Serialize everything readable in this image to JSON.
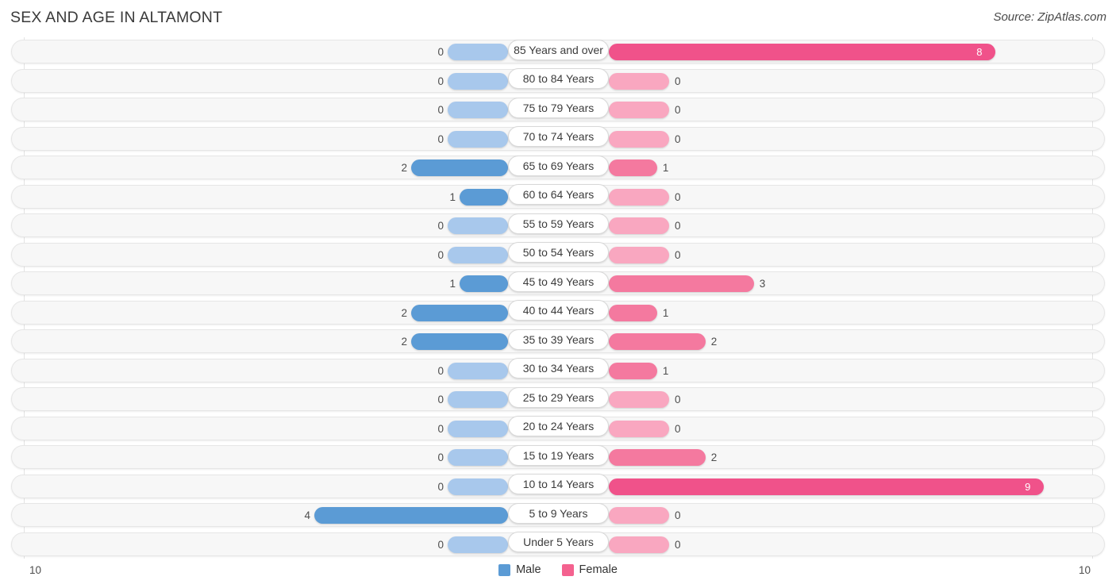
{
  "header": {
    "title": "SEX AND AGE IN ALTAMONT",
    "source": "Source: ZipAtlas.com"
  },
  "legend": {
    "male_label": "Male",
    "female_label": "Female",
    "male_color": "#5b9bd5",
    "female_color": "#f4628f"
  },
  "axis": {
    "left_label": "10",
    "right_label": "10"
  },
  "colors": {
    "male_filled": "#5b9bd5",
    "male_empty": "#a8c8ec",
    "female_filled": "#f4799f",
    "female_strong": "#f0528a",
    "female_empty": "#f9a7c0",
    "track": "#f7f7f7",
    "gridline": "#e3e3e3"
  },
  "chart_data": {
    "type": "bar",
    "title": "SEX AND AGE IN ALTAMONT",
    "subtitle": "Source: ZipAtlas.com",
    "xlabel": "",
    "ylabel": "",
    "orientation": "horizontal",
    "layout": "population-pyramid",
    "xlim": [
      10,
      10
    ],
    "axis_max": 10,
    "grid": true,
    "legend_position": "bottom-center",
    "categories": [
      "85 Years and over",
      "80 to 84 Years",
      "75 to 79 Years",
      "70 to 74 Years",
      "65 to 69 Years",
      "60 to 64 Years",
      "55 to 59 Years",
      "50 to 54 Years",
      "45 to 49 Years",
      "40 to 44 Years",
      "35 to 39 Years",
      "30 to 34 Years",
      "25 to 29 Years",
      "20 to 24 Years",
      "15 to 19 Years",
      "10 to 14 Years",
      "5 to 9 Years",
      "Under 5 Years"
    ],
    "series": [
      {
        "name": "Male",
        "values": [
          0,
          0,
          0,
          0,
          2,
          1,
          0,
          0,
          1,
          2,
          2,
          0,
          0,
          0,
          0,
          0,
          4,
          0
        ]
      },
      {
        "name": "Female",
        "values": [
          8,
          0,
          0,
          0,
          1,
          0,
          0,
          0,
          3,
          1,
          2,
          1,
          0,
          0,
          2,
          9,
          0,
          0
        ]
      }
    ]
  },
  "rows": [
    {
      "label": "85 Years and over",
      "male": "0",
      "female": "8"
    },
    {
      "label": "80 to 84 Years",
      "male": "0",
      "female": "0"
    },
    {
      "label": "75 to 79 Years",
      "male": "0",
      "female": "0"
    },
    {
      "label": "70 to 74 Years",
      "male": "0",
      "female": "0"
    },
    {
      "label": "65 to 69 Years",
      "male": "2",
      "female": "1"
    },
    {
      "label": "60 to 64 Years",
      "male": "1",
      "female": "0"
    },
    {
      "label": "55 to 59 Years",
      "male": "0",
      "female": "0"
    },
    {
      "label": "50 to 54 Years",
      "male": "0",
      "female": "0"
    },
    {
      "label": "45 to 49 Years",
      "male": "1",
      "female": "3"
    },
    {
      "label": "40 to 44 Years",
      "male": "2",
      "female": "1"
    },
    {
      "label": "35 to 39 Years",
      "male": "2",
      "female": "2"
    },
    {
      "label": "30 to 34 Years",
      "male": "0",
      "female": "1"
    },
    {
      "label": "25 to 29 Years",
      "male": "0",
      "female": "0"
    },
    {
      "label": "20 to 24 Years",
      "male": "0",
      "female": "0"
    },
    {
      "label": "15 to 19 Years",
      "male": "0",
      "female": "2"
    },
    {
      "label": "10 to 14 Years",
      "male": "0",
      "female": "9"
    },
    {
      "label": "5 to 9 Years",
      "male": "4",
      "female": "0"
    },
    {
      "label": "Under 5 Years",
      "male": "0",
      "female": "0"
    }
  ]
}
